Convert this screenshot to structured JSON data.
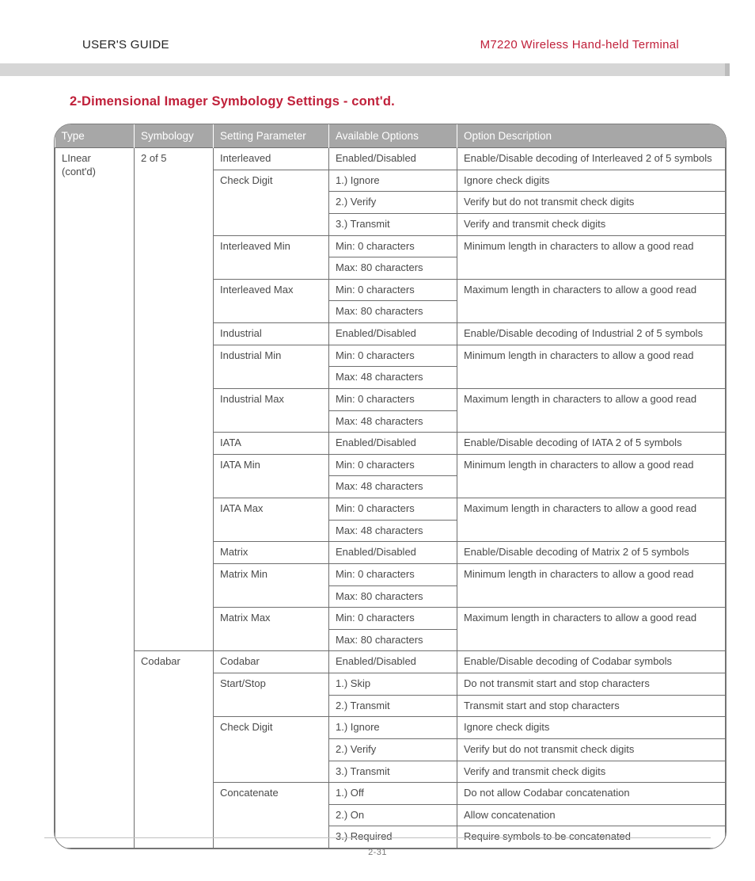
{
  "header": {
    "left": "USER'S GUIDE",
    "right": "M7220 Wireless Hand-held Terminal"
  },
  "section_title": "2-Dimensional Imager Symbology Settings - cont'd.",
  "table": {
    "headers": [
      "Type",
      "Symbology",
      "Setting Parameter",
      "Available Options",
      "Option Description"
    ],
    "groups": [
      {
        "type": "LInear (cont'd)",
        "symbologies": [
          {
            "name": "2 of 5",
            "params": [
              {
                "param": "Interleaved",
                "rows": [
                  {
                    "option": "Enabled/Disabled",
                    "desc": "Enable/Disable decoding of Interleaved 2 of 5 symbols"
                  }
                ]
              },
              {
                "param": "Check Digit",
                "rows": [
                  {
                    "option": "1.) Ignore",
                    "desc": "Ignore check digits"
                  },
                  {
                    "option": "2.) Verify",
                    "desc": "Verify but do not transmit check digits"
                  },
                  {
                    "option": "3.) Transmit",
                    "desc": "Verify and transmit check digits"
                  }
                ]
              },
              {
                "param": "Interleaved Min",
                "desc_span": "Minimum length in characters to allow a good read",
                "rows": [
                  {
                    "option": "Min: 0 characters"
                  },
                  {
                    "option": "Max: 80 characters"
                  }
                ]
              },
              {
                "param": "Interleaved Max",
                "desc_span": "Maximum length in characters to allow a good read",
                "rows": [
                  {
                    "option": "Min: 0 characters"
                  },
                  {
                    "option": "Max: 80 characters"
                  }
                ]
              },
              {
                "param": "Industrial",
                "rows": [
                  {
                    "option": "Enabled/Disabled",
                    "desc": "Enable/Disable decoding of Industrial 2 of 5 symbols"
                  }
                ]
              },
              {
                "param": "Industrial Min",
                "desc_span": "Minimum length in characters to allow a good read",
                "rows": [
                  {
                    "option": "Min: 0 characters"
                  },
                  {
                    "option": "Max: 48 characters"
                  }
                ]
              },
              {
                "param": "Industrial Max",
                "desc_span": "Maximum length in characters to allow a good read",
                "rows": [
                  {
                    "option": "Min: 0 characters"
                  },
                  {
                    "option": "Max: 48 characters"
                  }
                ]
              },
              {
                "param": "IATA",
                "rows": [
                  {
                    "option": "Enabled/Disabled",
                    "desc": "Enable/Disable decoding of IATA 2 of 5 symbols"
                  }
                ]
              },
              {
                "param": "IATA Min",
                "desc_span": "Minimum length in characters to allow a good read",
                "rows": [
                  {
                    "option": "Min: 0 characters"
                  },
                  {
                    "option": "Max: 48 characters"
                  }
                ]
              },
              {
                "param": "IATA Max",
                "desc_span": "Maximum length in characters to allow a good read",
                "rows": [
                  {
                    "option": "Min: 0 characters"
                  },
                  {
                    "option": "Max: 48 characters"
                  }
                ]
              },
              {
                "param": "Matrix",
                "rows": [
                  {
                    "option": "Enabled/Disabled",
                    "desc": "Enable/Disable decoding of Matrix 2 of 5 symbols"
                  }
                ]
              },
              {
                "param": "Matrix Min",
                "desc_span": "Minimum length in characters to allow a good read",
                "rows": [
                  {
                    "option": "Min: 0 characters"
                  },
                  {
                    "option": "Max: 80 characters"
                  }
                ]
              },
              {
                "param": "Matrix Max",
                "desc_span": "Maximum length in characters to allow a good read",
                "rows": [
                  {
                    "option": "Min: 0 characters"
                  },
                  {
                    "option": "Max: 80 characters"
                  }
                ]
              }
            ]
          },
          {
            "name": "Codabar",
            "params": [
              {
                "param": "Codabar",
                "rows": [
                  {
                    "option": "Enabled/Disabled",
                    "desc": "Enable/Disable decoding of Codabar symbols"
                  }
                ]
              },
              {
                "param": "Start/Stop",
                "rows": [
                  {
                    "option": "1.) Skip",
                    "desc": "Do not transmit start and stop characters"
                  },
                  {
                    "option": "2.) Transmit",
                    "desc": "Transmit start and stop characters"
                  }
                ]
              },
              {
                "param": "Check Digit",
                "rows": [
                  {
                    "option": "1.) Ignore",
                    "desc": "Ignore check digits"
                  },
                  {
                    "option": "2.) Verify",
                    "desc": "Verify but do not transmit check digits"
                  },
                  {
                    "option": "3.) Transmit",
                    "desc": "Verify and transmit check digits"
                  }
                ]
              },
              {
                "param": "Concatenate",
                "rows": [
                  {
                    "option": "1.) Off",
                    "desc": "Do not allow Codabar concatenation"
                  },
                  {
                    "option": "2.) On",
                    "desc": "Allow concatenation"
                  },
                  {
                    "option": "3.) Required",
                    "desc": "Require symbols to be concatenated"
                  }
                ]
              }
            ]
          }
        ]
      }
    ]
  },
  "footer": {
    "page": "2-31"
  }
}
